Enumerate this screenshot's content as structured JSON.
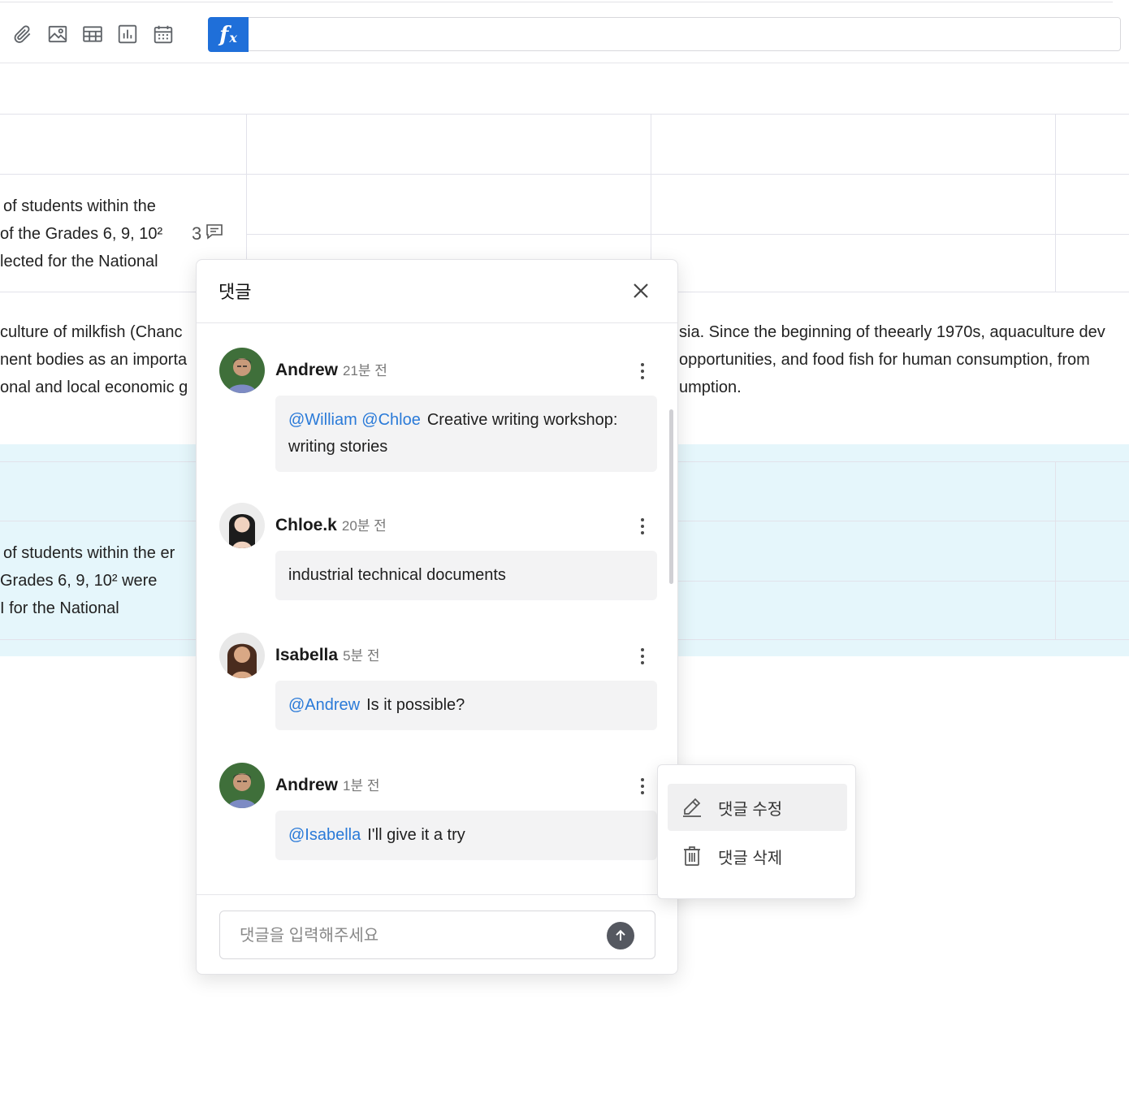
{
  "toolbar": {
    "icons": [
      "attachment-icon",
      "image-icon",
      "table-icon",
      "chart-icon",
      "calendar-icon"
    ],
    "formula_button_label": "f",
    "formula_button_sub": "x"
  },
  "document": {
    "row1": {
      "lines": [
        "of students within the",
        "of the Grades 6, 9, 10²",
        "lected for the National"
      ],
      "comment_count": "3"
    },
    "paragraph_left": [
      "culture of milkfish (Chanc",
      "nent bodies as an importa",
      "onal and local economic g"
    ],
    "paragraph_right": [
      "sia. Since the beginning of theearly 1970s, aquaculture dev",
      "opportunities, and food fish for human consumption, from",
      "umption."
    ],
    "row2": {
      "lines": [
        "of students within the er",
        "Grades 6, 9, 10² were",
        "I for the National"
      ]
    }
  },
  "comments_panel": {
    "title": "댓글",
    "comments": [
      {
        "author": "Andrew",
        "time": "21분 전",
        "mention": "@William @Chloe",
        "text": "Creative writing workshop: writing stories"
      },
      {
        "author": "Chloe.k",
        "time": "20분 전",
        "mention": "",
        "text": "industrial technical documents"
      },
      {
        "author": "Isabella",
        "time": "5분 전",
        "mention": "@Andrew",
        "text": "Is it possible?"
      },
      {
        "author": "Andrew",
        "time": "1분 전",
        "mention": "@Isabella",
        "text": "I'll give it a try"
      }
    ],
    "input_placeholder": "댓글을 입력해주세요"
  },
  "context_menu": {
    "items": [
      {
        "label": "댓글 수정",
        "icon": "pencil-icon"
      },
      {
        "label": "댓글 삭제",
        "icon": "trash-icon"
      }
    ]
  },
  "colors": {
    "accent": "#1f6fd9",
    "mention": "#2a7ad8",
    "highlight_row": "#e5f6fb"
  }
}
